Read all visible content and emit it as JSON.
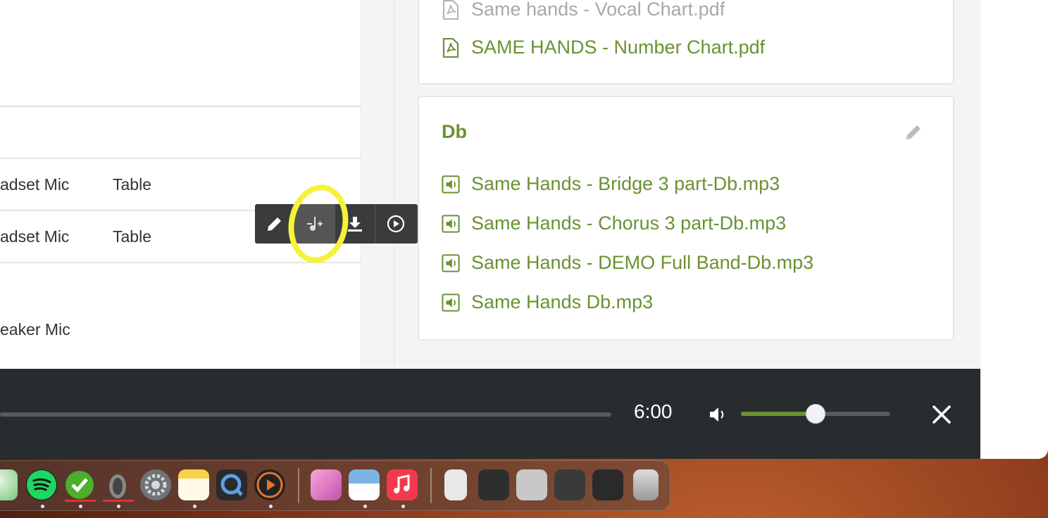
{
  "left_table": {
    "rows": [
      {
        "col1": "adset Mic",
        "col2": "Table"
      },
      {
        "col1": "adset Mic",
        "col2": "Table"
      },
      {
        "col1": "eaker Mic",
        "col2": ""
      }
    ]
  },
  "top_card": {
    "files": [
      {
        "name": "Same hands - Vocal Chart.pdf",
        "icon": "pdf-icon"
      },
      {
        "name": "SAME HANDS - Number Chart.pdf",
        "icon": "pdf-icon"
      }
    ]
  },
  "db_card": {
    "title": "Db",
    "files": [
      {
        "name": "Same Hands - Bridge 3 part-Db.mp3",
        "icon": "audio-file-icon"
      },
      {
        "name": "Same Hands - Chorus 3 part-Db.mp3",
        "icon": "audio-file-icon"
      },
      {
        "name": "Same Hands - DEMO Full Band-Db.mp3",
        "icon": "audio-file-icon"
      },
      {
        "name": "Same Hands Db.mp3",
        "icon": "audio-file-icon"
      }
    ]
  },
  "toolbar": {
    "buttons": [
      "edit-icon",
      "add-music-icon",
      "download-icon",
      "play-circle-icon"
    ]
  },
  "player": {
    "time": "6:00",
    "volume": 0.5
  },
  "colors": {
    "accent": "#6a9232",
    "player_bg": "#282c2f",
    "highlight": "#f6f23a"
  }
}
